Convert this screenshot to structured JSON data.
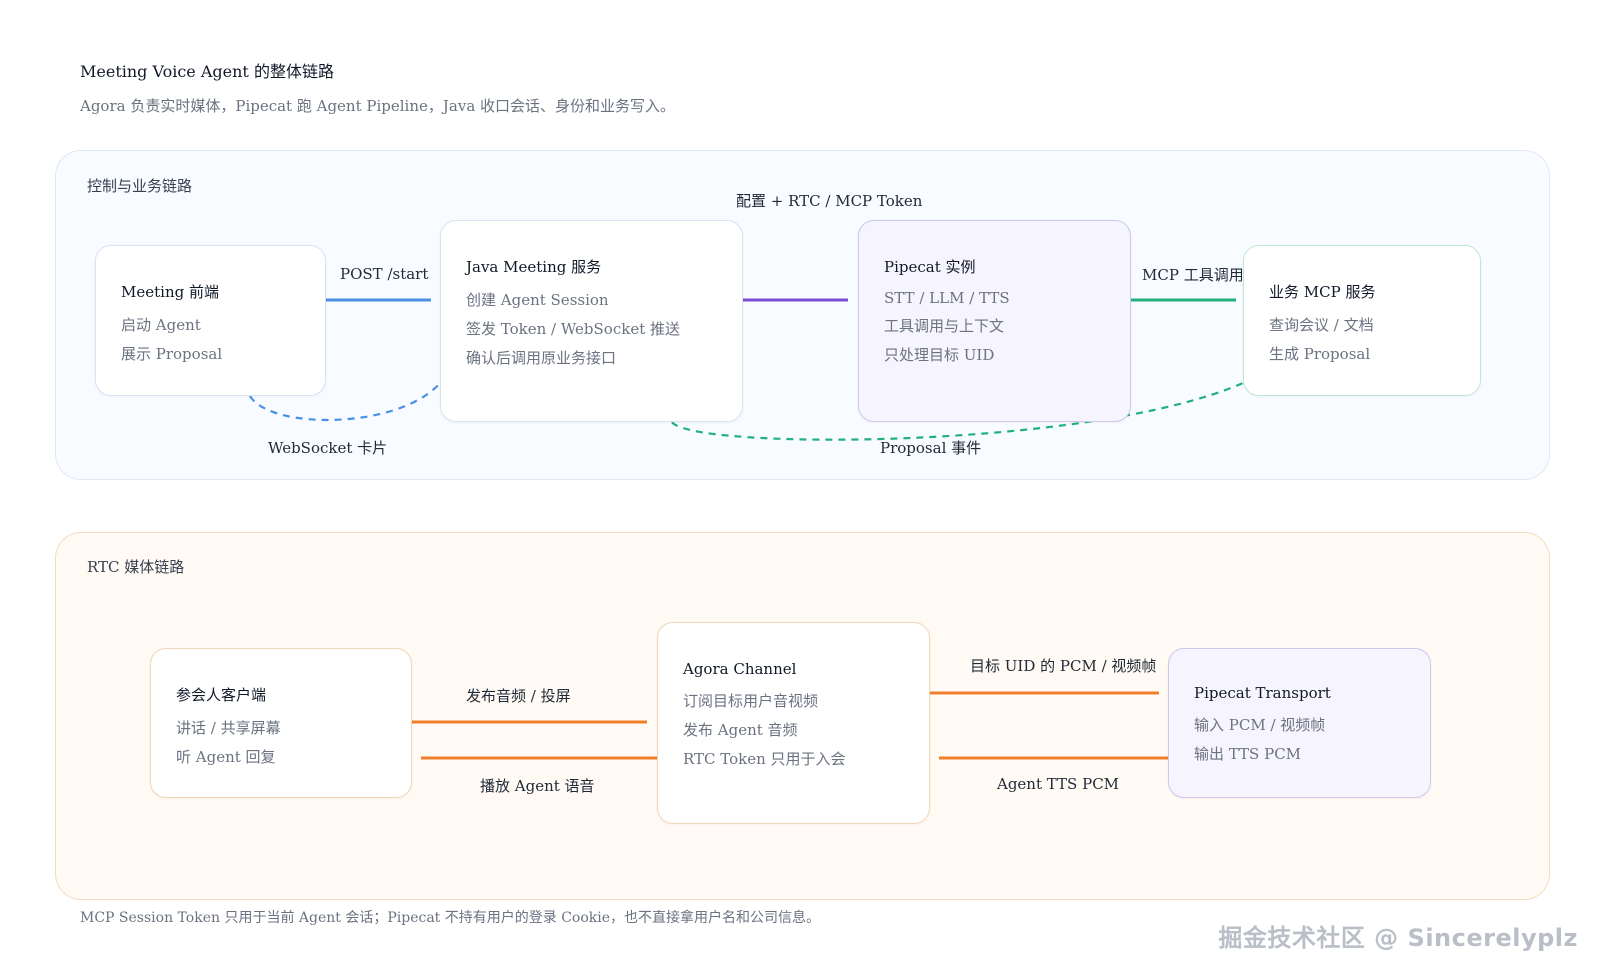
{
  "header": {
    "title": "Meeting Voice Agent 的整体链路",
    "subtitle": "Agora 负责实时媒体，Pipecat 跑 Agent Pipeline，Java 收口会话、身份和业务写入。"
  },
  "control": {
    "title": "控制与业务链路",
    "nodes": {
      "frontend": {
        "title": "Meeting 前端",
        "lines": [
          "启动 Agent",
          "展示 Proposal"
        ]
      },
      "java": {
        "title": "Java Meeting 服务",
        "lines": [
          "创建 Agent Session",
          "签发 Token / WebSocket 推送",
          "确认后调用原业务接口"
        ]
      },
      "pipecat": {
        "title": "Pipecat 实例",
        "lines": [
          "STT / LLM / TTS",
          "工具调用与上下文",
          "只处理目标 UID"
        ]
      },
      "mcp": {
        "title": "业务 MCP 服务",
        "lines": [
          "查询会议 / 文档",
          "生成 Proposal"
        ]
      }
    },
    "edges": {
      "post_start": "POST /start",
      "config_token": "配置 + RTC / MCP Token",
      "mcp_call": "MCP 工具调用",
      "websocket_card": "WebSocket 卡片",
      "proposal_event": "Proposal 事件"
    },
    "colors": {
      "post_start": "#4a90e2",
      "config_token": "#7c4dd6",
      "mcp_call": "#22b07d",
      "dashed_blue": "#4a90e2",
      "dashed_green": "#22b07d"
    }
  },
  "rtc": {
    "title": "RTC 媒体链路",
    "nodes": {
      "client": {
        "title": "参会人客户端",
        "lines": [
          "讲话 / 共享屏幕",
          "听 Agent 回复"
        ]
      },
      "channel": {
        "title": "Agora Channel",
        "lines": [
          "订阅目标用户音视频",
          "发布 Agent 音频",
          "RTC Token 只用于入会"
        ]
      },
      "transport": {
        "title": "Pipecat Transport",
        "lines": [
          "输入 PCM / 视频帧",
          "输出 TTS PCM"
        ]
      }
    },
    "edges": {
      "publish_av": "发布音频 / 投屏",
      "play_agent": "播放 Agent 语音",
      "target_pcm": "目标 UID 的 PCM / 视频帧",
      "agent_tts": "Agent TTS PCM"
    },
    "colors": {
      "edge": "#f07f2c"
    }
  },
  "footer": {
    "note": "MCP Session Token 只用于当前 Agent 会话；Pipecat 不持有用户的登录 Cookie，也不直接拿用户名和公司信息。",
    "watermark": "掘金技术社区 @ Sincerelyplz"
  }
}
